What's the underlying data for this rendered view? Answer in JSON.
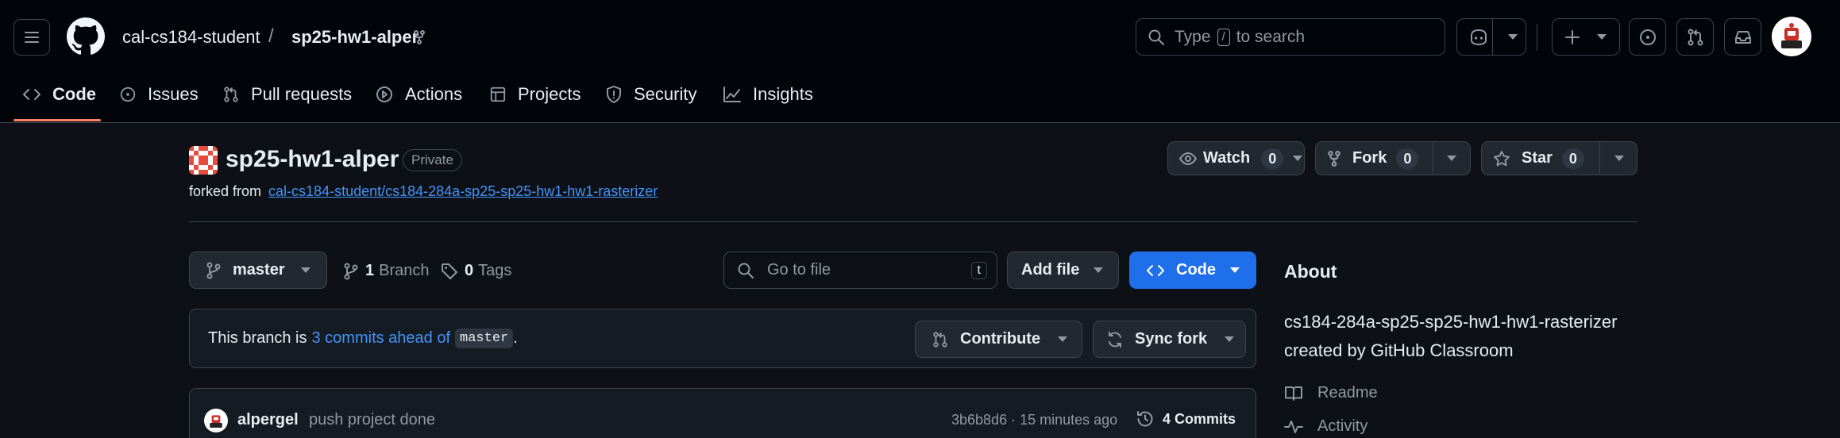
{
  "header": {
    "owner": "cal-cs184-student",
    "slash": "/",
    "repo": "sp25-hw1-alper",
    "search_prefix": "Type",
    "search_key": "/",
    "search_suffix": "to search"
  },
  "tabs": [
    {
      "label": "Code"
    },
    {
      "label": "Issues"
    },
    {
      "label": "Pull requests"
    },
    {
      "label": "Actions"
    },
    {
      "label": "Projects"
    },
    {
      "label": "Security"
    },
    {
      "label": "Insights"
    }
  ],
  "repo": {
    "name": "sp25-hw1-alper",
    "visibility": "Private",
    "forked_prefix": "forked from",
    "forked_link": "cal-cs184-student/cs184-284a-sp25-sp25-hw1-hw1-rasterizer"
  },
  "actions": {
    "watch_label": "Watch",
    "watch_count": "0",
    "fork_label": "Fork",
    "fork_count": "0",
    "star_label": "Star",
    "star_count": "0"
  },
  "toolbar": {
    "branch": "master",
    "branches_count": "1",
    "branches_label": "Branch",
    "tags_count": "0",
    "tags_label": "Tags",
    "goto_placeholder": "Go to file",
    "goto_key": "t",
    "add_file": "Add file",
    "code": "Code"
  },
  "branch_status": {
    "prefix": "This branch is",
    "link": "3 commits ahead of",
    "base": "master",
    "suffix": ".",
    "contribute": "Contribute",
    "sync": "Sync fork"
  },
  "commit": {
    "author": "alpergel",
    "message": "push project done",
    "meta": "3b6b8d6 · 15 minutes ago",
    "count": "4 Commits"
  },
  "about": {
    "heading": "About",
    "description": "cs184-284a-sp25-sp25-hw1-hw1-rasterizer created by GitHub Classroom",
    "readme": "Readme",
    "activity": "Activity"
  },
  "colors": {
    "accent": "#1f6feb",
    "link": "#4493f8",
    "underline": "#f78166",
    "background": "#0d1117",
    "header_bg": "#010409"
  },
  "icons": [
    "hamburger-icon",
    "github-logo",
    "fork-icon",
    "search-icon",
    "copilot-icon",
    "plus-icon",
    "issue-icon",
    "pull-request-icon",
    "inbox-icon",
    "code-icon",
    "play-icon",
    "table-icon",
    "shield-icon",
    "graph-icon",
    "eye-icon",
    "star-icon",
    "branch-icon",
    "tag-icon",
    "sync-icon",
    "history-icon",
    "book-icon",
    "pulse-icon"
  ]
}
